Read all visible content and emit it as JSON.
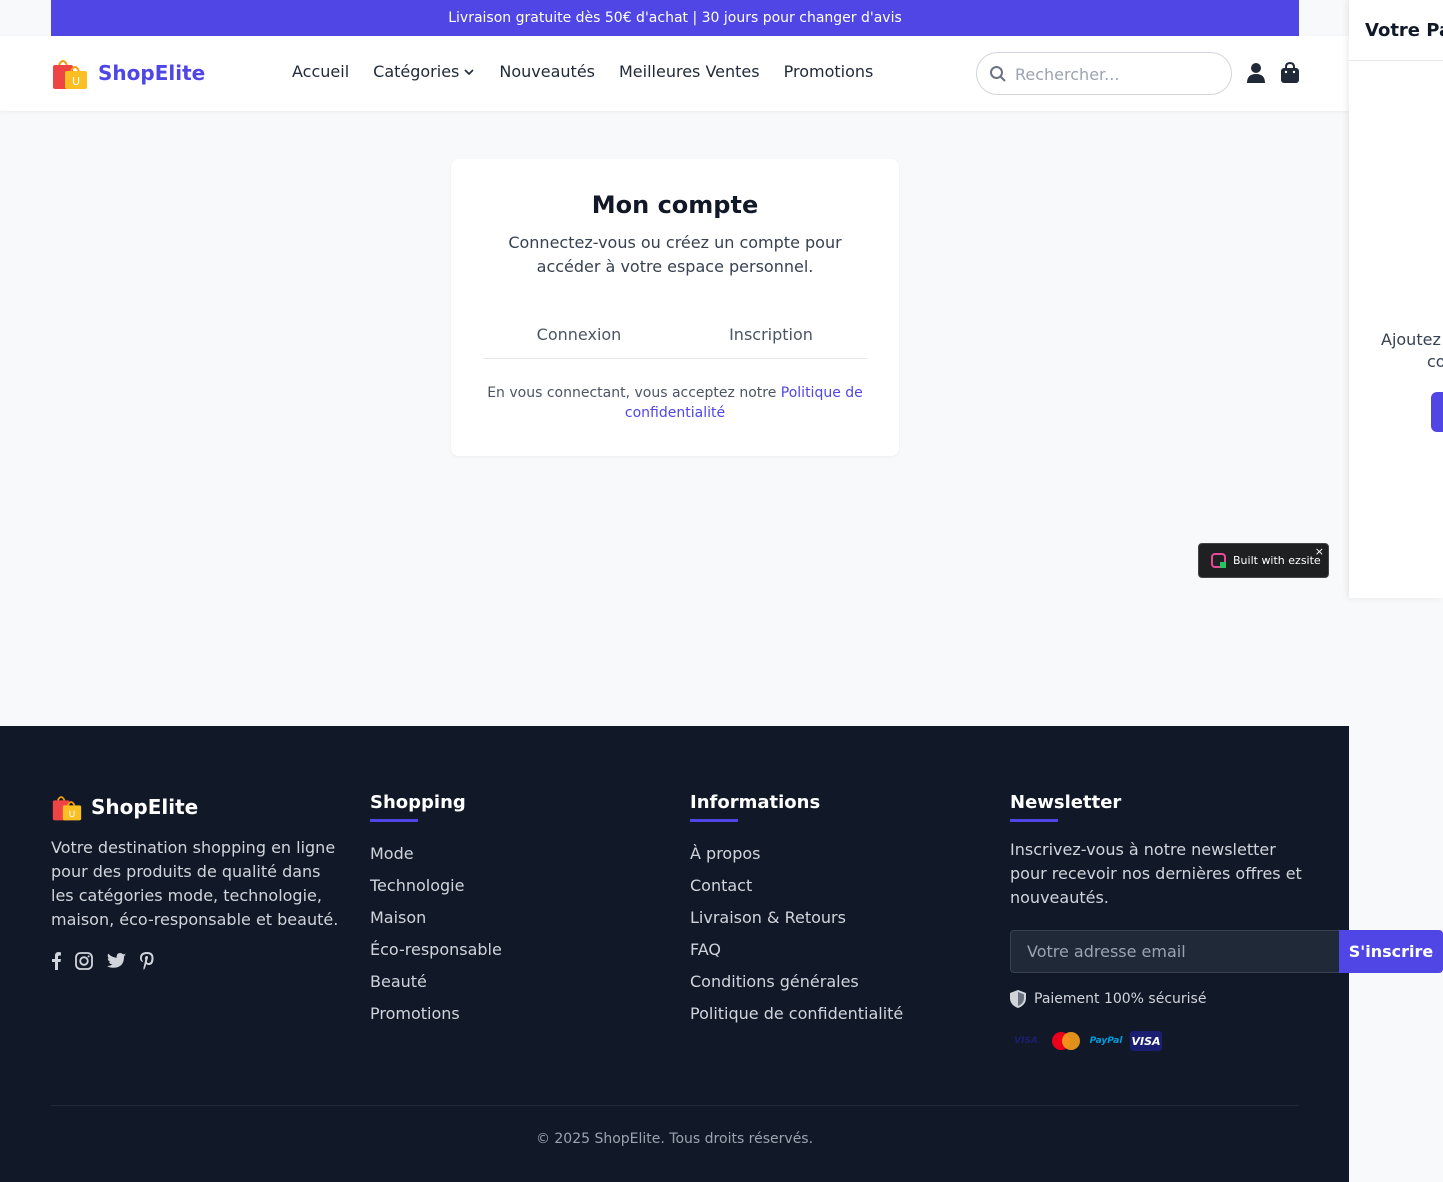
{
  "promo": {
    "text": "Livraison gratuite dès 50€ d'achat | 30 jours pour changer d'avis"
  },
  "brand": {
    "name": "ShopElite",
    "accent": "#4f46e5",
    "logo_icon": "shopping-bag-icon"
  },
  "nav": {
    "items": [
      "Accueil",
      "Catégories",
      "Nouveautés",
      "Meilleures Ventes",
      "Promotions"
    ]
  },
  "search": {
    "placeholder": "Rechercher..."
  },
  "account": {
    "title": "Mon compte",
    "subtitle": "Connectez-vous ou créez un compte pour accéder à votre espace personnel.",
    "tabs": [
      "Connexion",
      "Inscription"
    ],
    "terms_prefix": "En vous connectant, vous acceptez notre",
    "terms_link": "Politique de confidentialité"
  },
  "badge": {
    "text": "Built with ezsite",
    "close": "×"
  },
  "footer": {
    "brand_desc": "Votre destination shopping en ligne pour des produits de qualité dans les catégories mode, technologie, maison, éco-responsable et beauté.",
    "shopping": {
      "title": "Shopping",
      "items": [
        "Mode",
        "Technologie",
        "Maison",
        "Éco-responsable",
        "Beauté",
        "Promotions"
      ]
    },
    "informations": {
      "title": "Informations",
      "items": [
        "À propos",
        "Contact",
        "Livraison & Retours",
        "FAQ",
        "Conditions générales",
        "Politique de confidentialité"
      ]
    },
    "newsletter": {
      "title": "Newsletter",
      "text": "Inscrivez-vous à notre newsletter pour recevoir nos dernières offres et nouveautés.",
      "placeholder": "Votre adresse email",
      "button": "S'inscrire",
      "secure": "Paiement 100% sécurisé",
      "payments": [
        "VISA",
        "MasterCard",
        "PayPal",
        "VISA"
      ]
    },
    "copyright": "© 2025 ShopElite. Tous droits réservés."
  },
  "drawer": {
    "title": "Votre Pa",
    "empty_line1": "Ajoutez",
    "empty_line2": "co"
  }
}
